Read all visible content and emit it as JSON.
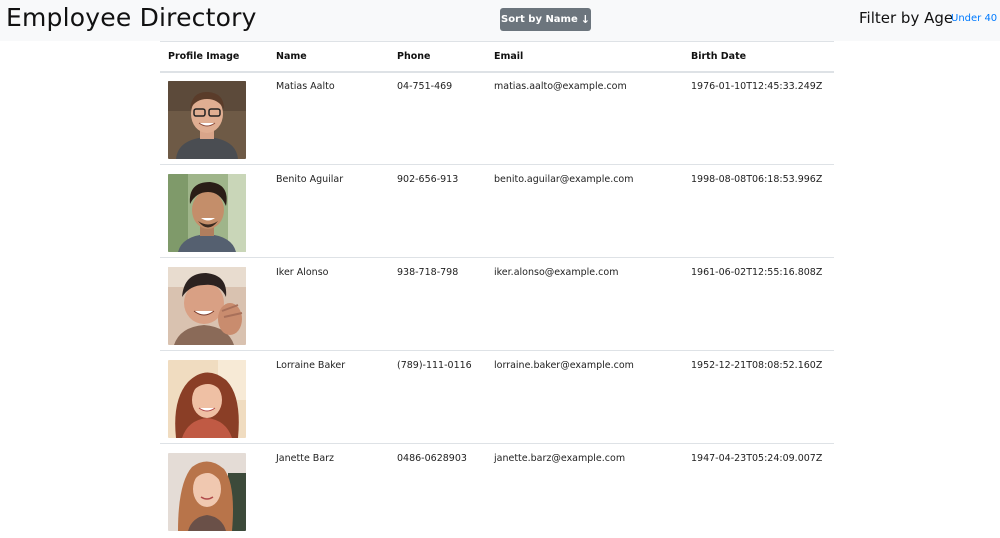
{
  "header": {
    "title": "Employee Directory",
    "sort_button": {
      "label": "Sort by Name",
      "icon": "arrow-down-icon"
    },
    "filter": {
      "label": "Filter by Age",
      "link": "Under 40"
    }
  },
  "table": {
    "columns": [
      "Profile Image",
      "Name",
      "Phone",
      "Email",
      "Birth Date"
    ],
    "rows": [
      {
        "name": "Matias Aalto",
        "phone": "04-751-469",
        "email": "matias.aalto@example.com",
        "birth": "1976-01-10T12:45:33.249Z"
      },
      {
        "name": "Benito Aguilar",
        "phone": "902-656-913",
        "email": "benito.aguilar@example.com",
        "birth": "1998-08-08T06:18:53.996Z"
      },
      {
        "name": "Iker Alonso",
        "phone": "938-718-798",
        "email": "iker.alonso@example.com",
        "birth": "1961-06-02T12:55:16.808Z"
      },
      {
        "name": "Lorraine Baker",
        "phone": "(789)-111-0116",
        "email": "lorraine.baker@example.com",
        "birth": "1952-12-21T08:08:52.160Z"
      },
      {
        "name": "Janette Barz",
        "phone": "0486-0628903",
        "email": "janette.barz@example.com",
        "birth": "1947-04-23T05:24:09.007Z"
      }
    ]
  },
  "colors": {
    "topbar_bg": "#f8f9fa",
    "button_bg": "#6c757d",
    "link": "#007bff",
    "border": "#dee2e6"
  }
}
